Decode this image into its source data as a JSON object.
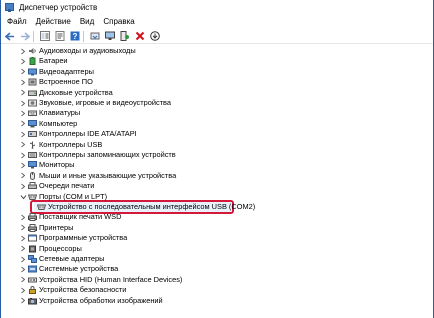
{
  "window": {
    "title": "Диспетчер устройств"
  },
  "menu": [
    {
      "id": "file",
      "label": "Файл"
    },
    {
      "id": "action",
      "label": "Действие"
    },
    {
      "id": "view",
      "label": "Вид"
    },
    {
      "id": "help",
      "label": "Справка"
    }
  ],
  "toolbar": [
    {
      "name": "back-arrow-icon"
    },
    {
      "name": "forward-arrow-icon"
    },
    {
      "sep": true
    },
    {
      "name": "show-hide-tree-icon"
    },
    {
      "name": "properties-icon"
    },
    {
      "name": "help-icon"
    },
    {
      "sep": true
    },
    {
      "name": "update-driver-icon"
    },
    {
      "name": "monitor-icon"
    },
    {
      "name": "scan-hardware-icon"
    },
    {
      "name": "delete-x-icon"
    },
    {
      "name": "download-icon"
    }
  ],
  "tree": [
    {
      "label": "Аудиовходы и аудиовыходы",
      "icon": "speaker-icon",
      "expanded": false
    },
    {
      "label": "Батареи",
      "icon": "battery-icon",
      "expanded": false
    },
    {
      "label": "Видеоадаптеры",
      "icon": "display-adapter-icon",
      "expanded": false
    },
    {
      "label": "Встроенное ПО",
      "icon": "firmware-icon",
      "expanded": false
    },
    {
      "label": "Дисковые устройства",
      "icon": "disk-icon",
      "expanded": false
    },
    {
      "label": "Звуковые, игровые и видеоустройства",
      "icon": "sound-icon",
      "expanded": false
    },
    {
      "label": "Клавиатуры",
      "icon": "keyboard-icon",
      "expanded": false
    },
    {
      "label": "Компьютер",
      "icon": "computer-icon",
      "expanded": false
    },
    {
      "label": "Контроллеры IDE ATA/ATAPI",
      "icon": "ide-controller-icon",
      "expanded": false
    },
    {
      "label": "Контроллеры USB",
      "icon": "usb-icon",
      "expanded": false
    },
    {
      "label": "Контроллеры запоминающих устройств",
      "icon": "storage-controller-icon",
      "expanded": false
    },
    {
      "label": "Мониторы",
      "icon": "monitor-icon",
      "expanded": false
    },
    {
      "label": "Мыши и иные указывающие устройства",
      "icon": "mouse-icon",
      "expanded": false
    },
    {
      "label": "Очереди печати",
      "icon": "print-queue-icon",
      "expanded": false
    },
    {
      "label": "Порты (COM и LPT)",
      "icon": "port-icon",
      "expanded": true
    },
    {
      "label": "Устройство с последовательным интерфейсом USB (COM2)",
      "icon": "port-device-icon",
      "child": true,
      "selected": true
    },
    {
      "label": "Поставщик печати WSD",
      "icon": "printer-icon",
      "expanded": false
    },
    {
      "label": "Принтеры",
      "icon": "printer-icon",
      "expanded": false
    },
    {
      "label": "Программные устройства",
      "icon": "software-device-icon",
      "expanded": false
    },
    {
      "label": "Процессоры",
      "icon": "cpu-icon",
      "expanded": false
    },
    {
      "label": "Сетевые адаптеры",
      "icon": "network-icon",
      "expanded": false
    },
    {
      "label": "Системные устройства",
      "icon": "system-device-icon",
      "expanded": false
    },
    {
      "label": "Устройства HID (Human Interface Devices)",
      "icon": "hid-icon",
      "expanded": false
    },
    {
      "label": "Устройства безопасности",
      "icon": "security-device-icon",
      "expanded": false
    },
    {
      "label": "Устройства обработки изображений",
      "icon": "imaging-device-icon",
      "expanded": false
    }
  ],
  "colors": {
    "highlight_border": "#d4183a",
    "window_border": "#2a5fa8",
    "accent": "#2b6cc4"
  }
}
